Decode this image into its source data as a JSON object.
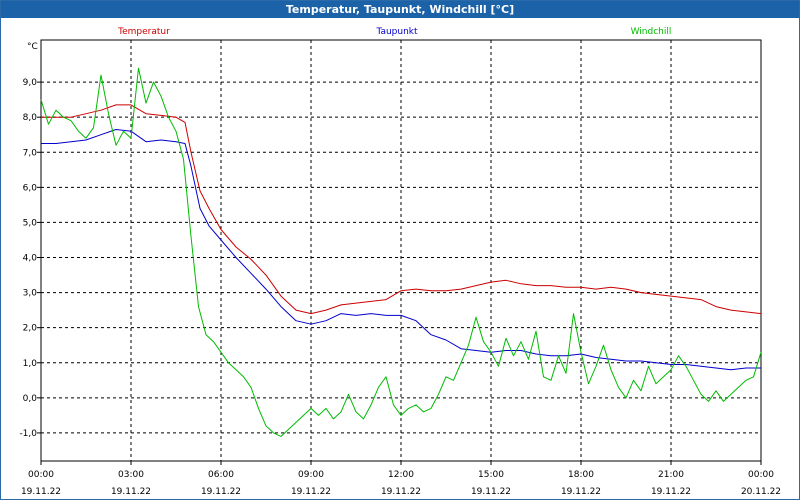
{
  "window": {
    "title": "Temperatur, Taupunkt, Windchill [°C]"
  },
  "chart_data": {
    "type": "line",
    "title": "Temperatur, Taupunkt, Windchill [°C]",
    "ylabel": "°C",
    "xlabel": "",
    "xlim": [
      0,
      24
    ],
    "ylim": [
      -1.8,
      10.2
    ],
    "grid": true,
    "legend_position": "top",
    "y_ticks": [
      {
        "value": -1,
        "label": "-1,0"
      },
      {
        "value": 0,
        "label": "0,0"
      },
      {
        "value": 1,
        "label": "1,0"
      },
      {
        "value": 2,
        "label": "2,0"
      },
      {
        "value": 3,
        "label": "3,0"
      },
      {
        "value": 4,
        "label": "4,0"
      },
      {
        "value": 5,
        "label": "5,0"
      },
      {
        "value": 6,
        "label": "6,0"
      },
      {
        "value": 7,
        "label": "7,0"
      },
      {
        "value": 8,
        "label": "8,0"
      },
      {
        "value": 9,
        "label": "9,0"
      }
    ],
    "x_ticks": [
      {
        "value": 0,
        "time": "00:00",
        "date": "19.11.22"
      },
      {
        "value": 3,
        "time": "03:00",
        "date": "19.11.22"
      },
      {
        "value": 6,
        "time": "06:00",
        "date": "19.11.22"
      },
      {
        "value": 9,
        "time": "09:00",
        "date": "19.11.22"
      },
      {
        "value": 12,
        "time": "12:00",
        "date": "19.11.22"
      },
      {
        "value": 15,
        "time": "15:00",
        "date": "19.11.22"
      },
      {
        "value": 18,
        "time": "18:00",
        "date": "19.11.22"
      },
      {
        "value": 21,
        "time": "21:00",
        "date": "19.11.22"
      },
      {
        "value": 24,
        "time": "00:00",
        "date": "20.11.22"
      }
    ],
    "series": [
      {
        "name": "Temperatur",
        "color": "#cc0000",
        "x": [
          0,
          0.5,
          1,
          1.5,
          2,
          2.5,
          3,
          3.5,
          4,
          4.5,
          4.8,
          5,
          5.3,
          5.6,
          6,
          6.5,
          7,
          7.5,
          8,
          8.5,
          9,
          9.5,
          10,
          10.5,
          11,
          11.5,
          12,
          12.5,
          13,
          13.5,
          14,
          14.5,
          15,
          15.5,
          16,
          16.5,
          17,
          17.5,
          18,
          18.5,
          19,
          19.5,
          20,
          20.5,
          21,
          21.5,
          22,
          22.5,
          23,
          23.5,
          24
        ],
        "values": [
          8.0,
          8.0,
          8.0,
          8.1,
          8.2,
          8.35,
          8.35,
          8.1,
          8.05,
          8.0,
          7.85,
          7.0,
          5.9,
          5.4,
          4.8,
          4.3,
          3.95,
          3.5,
          2.9,
          2.5,
          2.4,
          2.5,
          2.65,
          2.7,
          2.75,
          2.8,
          3.05,
          3.1,
          3.05,
          3.05,
          3.1,
          3.2,
          3.3,
          3.35,
          3.25,
          3.2,
          3.2,
          3.15,
          3.15,
          3.1,
          3.15,
          3.1,
          3.0,
          2.95,
          2.9,
          2.85,
          2.8,
          2.6,
          2.5,
          2.45,
          2.4
        ]
      },
      {
        "name": "Taupunkt",
        "color": "#0000cc",
        "x": [
          0,
          0.5,
          1,
          1.5,
          2,
          2.5,
          3,
          3.5,
          4,
          4.5,
          4.8,
          5,
          5.3,
          5.6,
          6,
          6.5,
          7,
          7.5,
          8,
          8.5,
          9,
          9.5,
          10,
          10.5,
          11,
          11.5,
          12,
          12.5,
          13,
          13.5,
          14,
          14.5,
          15,
          15.5,
          16,
          16.5,
          17,
          17.5,
          18,
          18.5,
          19,
          19.5,
          20,
          20.5,
          21,
          21.5,
          22,
          22.5,
          23,
          23.5,
          24
        ],
        "values": [
          7.25,
          7.25,
          7.3,
          7.35,
          7.5,
          7.65,
          7.6,
          7.3,
          7.35,
          7.3,
          7.25,
          6.6,
          5.4,
          4.9,
          4.5,
          4.0,
          3.55,
          3.1,
          2.6,
          2.2,
          2.1,
          2.2,
          2.4,
          2.35,
          2.4,
          2.35,
          2.35,
          2.2,
          1.8,
          1.65,
          1.4,
          1.35,
          1.3,
          1.35,
          1.35,
          1.25,
          1.2,
          1.2,
          1.25,
          1.15,
          1.1,
          1.05,
          1.05,
          1.0,
          0.95,
          0.95,
          0.9,
          0.85,
          0.8,
          0.85,
          0.85
        ]
      },
      {
        "name": "Windchill",
        "color": "#00bb00",
        "x": [
          0,
          0.25,
          0.5,
          0.75,
          1,
          1.25,
          1.5,
          1.75,
          2,
          2.25,
          2.5,
          2.75,
          3,
          3.25,
          3.5,
          3.75,
          4,
          4.25,
          4.5,
          4.75,
          5,
          5.25,
          5.5,
          5.75,
          6,
          6.25,
          6.5,
          6.75,
          7,
          7.25,
          7.5,
          7.75,
          8,
          8.25,
          8.5,
          8.75,
          9,
          9.25,
          9.5,
          9.75,
          10,
          10.25,
          10.5,
          10.75,
          11,
          11.25,
          11.5,
          11.75,
          12,
          12.25,
          12.5,
          12.75,
          13,
          13.25,
          13.5,
          13.75,
          14,
          14.25,
          14.5,
          14.75,
          15,
          15.25,
          15.5,
          15.75,
          16,
          16.25,
          16.5,
          16.75,
          17,
          17.25,
          17.5,
          17.75,
          18,
          18.25,
          18.5,
          18.75,
          19,
          19.25,
          19.5,
          19.75,
          20,
          20.25,
          20.5,
          20.75,
          21,
          21.25,
          21.5,
          21.75,
          22,
          22.25,
          22.5,
          22.75,
          23,
          23.25,
          23.5,
          23.75,
          24
        ],
        "values": [
          8.5,
          7.8,
          8.2,
          8.0,
          7.9,
          7.6,
          7.4,
          7.7,
          9.2,
          8.1,
          7.2,
          7.6,
          7.4,
          9.4,
          8.4,
          9.0,
          8.6,
          8.0,
          7.6,
          6.8,
          4.6,
          2.6,
          1.8,
          1.6,
          1.3,
          1.0,
          0.8,
          0.6,
          0.3,
          -0.3,
          -0.8,
          -1.0,
          -1.1,
          -0.9,
          -0.7,
          -0.5,
          -0.3,
          -0.5,
          -0.3,
          -0.6,
          -0.4,
          0.1,
          -0.4,
          -0.6,
          -0.2,
          0.3,
          0.6,
          -0.2,
          -0.5,
          -0.3,
          -0.2,
          -0.4,
          -0.3,
          0.1,
          0.6,
          0.5,
          1.0,
          1.5,
          2.3,
          1.6,
          1.3,
          0.9,
          1.7,
          1.2,
          1.6,
          1.1,
          1.9,
          0.6,
          0.5,
          1.2,
          0.7,
          2.4,
          1.3,
          0.4,
          0.9,
          1.5,
          0.8,
          0.3,
          0.0,
          0.5,
          0.2,
          0.9,
          0.4,
          0.6,
          0.8,
          1.2,
          0.9,
          0.5,
          0.1,
          -0.1,
          0.2,
          -0.1,
          0.1,
          0.3,
          0.5,
          0.6,
          1.3
        ]
      }
    ]
  }
}
